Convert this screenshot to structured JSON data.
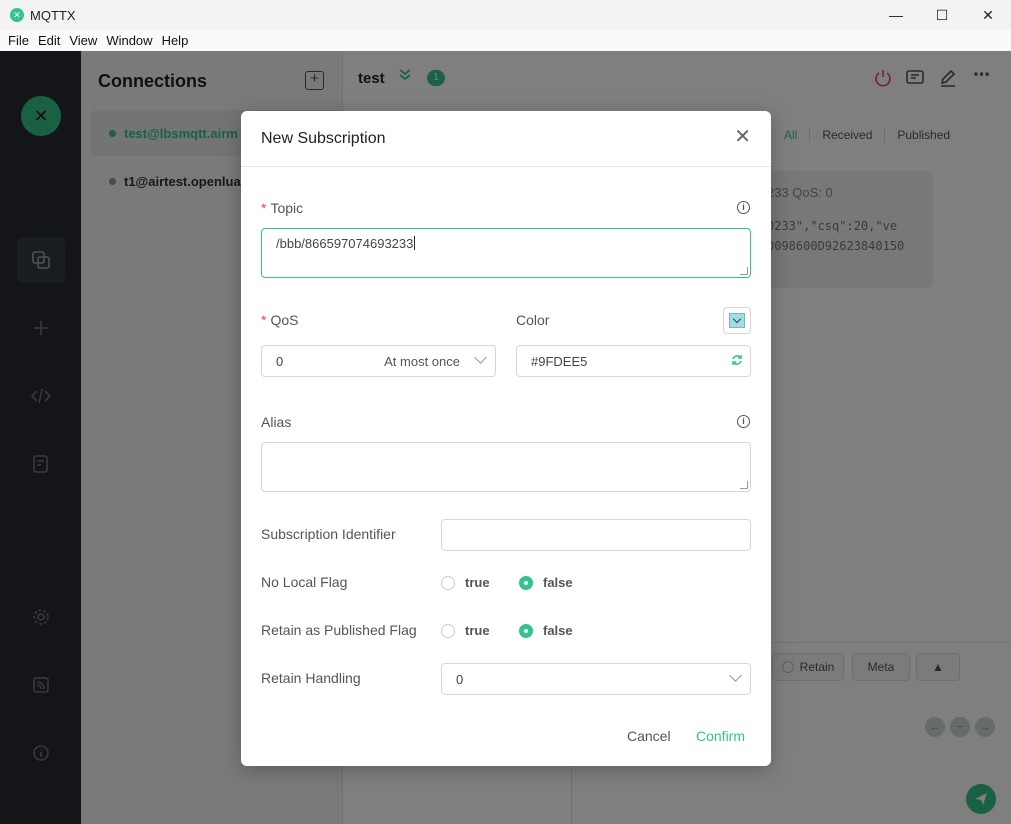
{
  "window": {
    "title": "MQTTX",
    "minimize": "—",
    "maximize": "☐",
    "close": "✕"
  },
  "menu": [
    "File",
    "Edit",
    "View",
    "Window",
    "Help"
  ],
  "sidebar": {
    "logo": "✕"
  },
  "connections": {
    "title": "Connections",
    "add": "+",
    "items": [
      {
        "label": "test@lbsmqtt.airm",
        "status": "connected"
      },
      {
        "label": "t1@airtest.openlua",
        "status": "offline"
      }
    ]
  },
  "main": {
    "title": "test",
    "badge": "1",
    "filters": [
      "All",
      "Received",
      "Published"
    ],
    "message": {
      "meta": "233   QoS: 0",
      "payload_line1": "0233\",\"csq\":20,\"ve",
      "payload_line2": "0098600D92623840150"
    },
    "retain_label": "Retain",
    "meta_label": "Meta"
  },
  "modal": {
    "title": "New Subscription",
    "topic": {
      "label": "Topic",
      "value": "/bbb/866597074693233"
    },
    "qos": {
      "label": "QoS",
      "value": "0",
      "description": "At most once"
    },
    "color": {
      "label": "Color",
      "value": "#9FDEE5",
      "swatch": "#9fdee5"
    },
    "alias": {
      "label": "Alias",
      "value": ""
    },
    "subscription_identifier": {
      "label": "Subscription Identifier",
      "value": ""
    },
    "no_local_flag": {
      "label": "No Local Flag",
      "options": [
        "true",
        "false"
      ],
      "selected": "false"
    },
    "retain_as_published": {
      "label": "Retain as Published Flag",
      "options": [
        "true",
        "false"
      ],
      "selected": "false"
    },
    "retain_handling": {
      "label": "Retain Handling",
      "value": "0"
    },
    "cancel": "Cancel",
    "confirm": "Confirm"
  },
  "colors": {
    "accent": "#34c388",
    "required": "#e44444",
    "nav_bg": "#262b30"
  }
}
